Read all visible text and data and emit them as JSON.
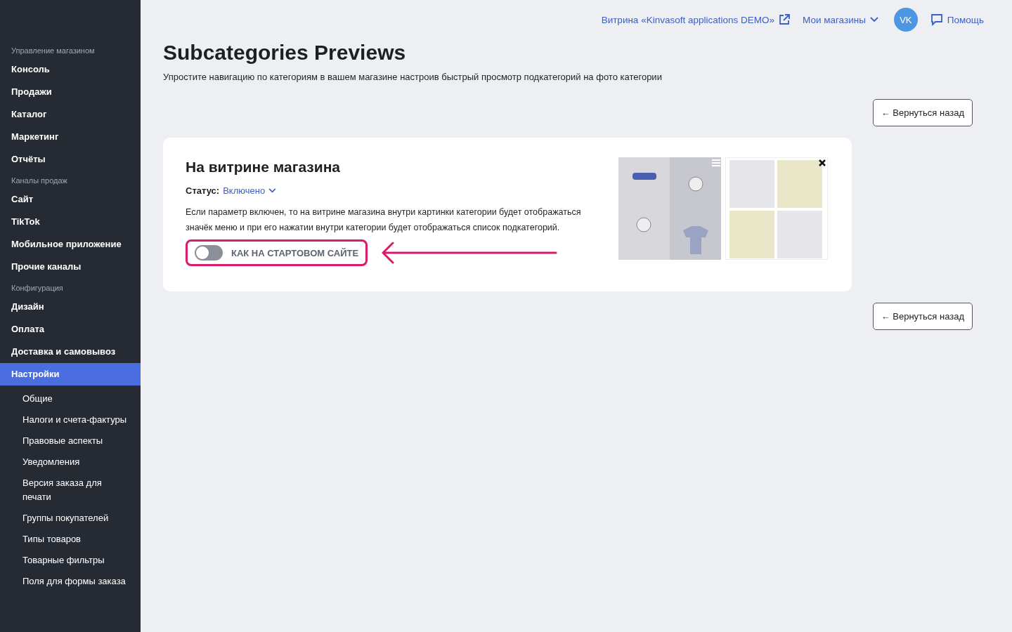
{
  "sidebar": {
    "sections": [
      {
        "title": "Управление магазином",
        "items": [
          {
            "label": "Консоль",
            "selected": false
          },
          {
            "label": "Продажи",
            "selected": false
          },
          {
            "label": "Каталог",
            "selected": false
          },
          {
            "label": "Маркетинг",
            "selected": false
          },
          {
            "label": "Отчёты",
            "selected": false
          }
        ]
      },
      {
        "title": "Каналы продаж",
        "items": [
          {
            "label": "Сайт",
            "selected": false
          },
          {
            "label": "TikTok",
            "selected": false
          },
          {
            "label": "Мобильное приложение",
            "selected": false
          },
          {
            "label": "Прочие каналы",
            "selected": false
          }
        ]
      },
      {
        "title": "Конфигурация",
        "items": [
          {
            "label": "Дизайн",
            "selected": false
          },
          {
            "label": "Оплата",
            "selected": false
          },
          {
            "label": "Доставка и самовывоз",
            "selected": false
          },
          {
            "label": "Настройки",
            "selected": true,
            "children": [
              {
                "label": "Общие",
                "selected": false
              },
              {
                "label": "Налоги и счета-фактуры",
                "selected": false
              },
              {
                "label": "Правовые аспекты",
                "selected": false
              },
              {
                "label": "Уведомления",
                "selected": false
              },
              {
                "label": "Версия заказа для печати",
                "selected": false
              },
              {
                "label": "Группы покупателей",
                "selected": false
              },
              {
                "label": "Типы товаров",
                "selected": false
              },
              {
                "label": "Товарные фильтры",
                "selected": false
              },
              {
                "label": "Поля для формы заказа",
                "selected": false
              }
            ]
          }
        ]
      }
    ]
  },
  "topbar": {
    "storefront_link": "Витрина «Kinvasoft applications DEMO»",
    "stores_menu": "Мои магазины",
    "avatar": "VK",
    "help": "Помощь"
  },
  "page": {
    "title": "Subcategories Previews",
    "description": "Упростите навигацию по категориям в вашем магазине настроив быстрый просмотр подкатегорий на фото категории",
    "back_button_top": "← Вернуться назад",
    "back_button_bottom": "← Вернуться назад"
  },
  "card": {
    "title": "На витрине магазина",
    "status_label": "Статус:",
    "status_value": "Включено",
    "description": "Если параметр включен, то на витрине магазина внутри картинки категории будет отображаться значёк меню и при его нажатии внутри категории будет отображаться список подкатегорий.",
    "toggle": {
      "label": "КАК НА СТАРТОВОМ САЙТЕ",
      "on": false
    }
  }
}
